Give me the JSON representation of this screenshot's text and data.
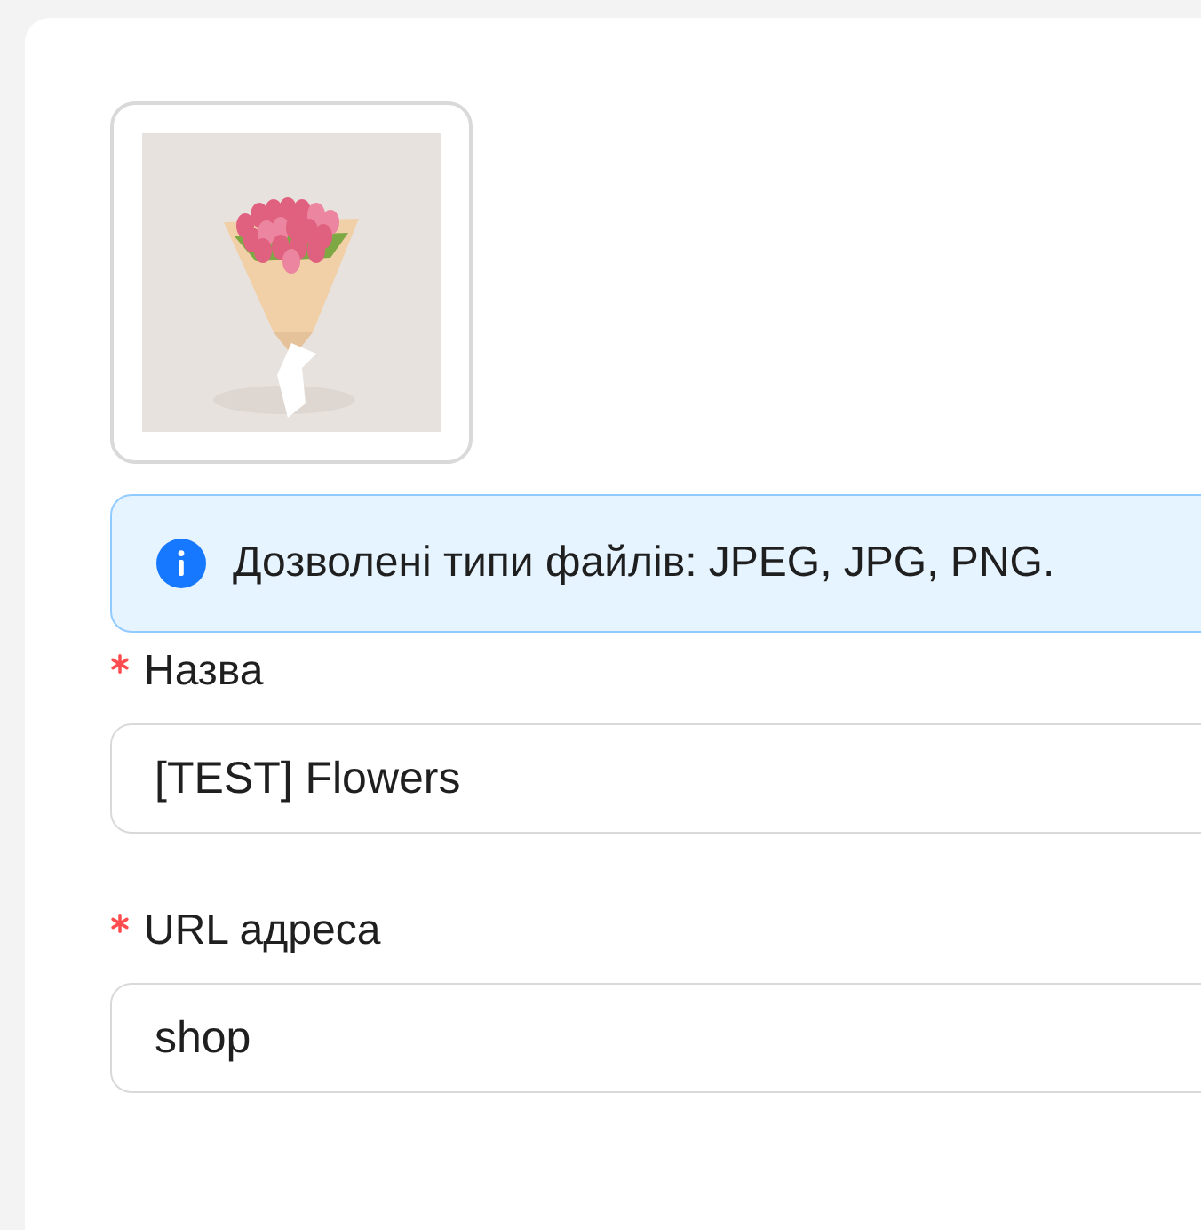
{
  "alert": {
    "kind": "info",
    "text": "Дозволені типи файлів: JPEG, JPG, PNG."
  },
  "fields": [
    {
      "label": "Назва",
      "required": true,
      "value": "[TEST] Flowers"
    },
    {
      "label": "URL адреса",
      "required": true,
      "value": "shop"
    }
  ]
}
